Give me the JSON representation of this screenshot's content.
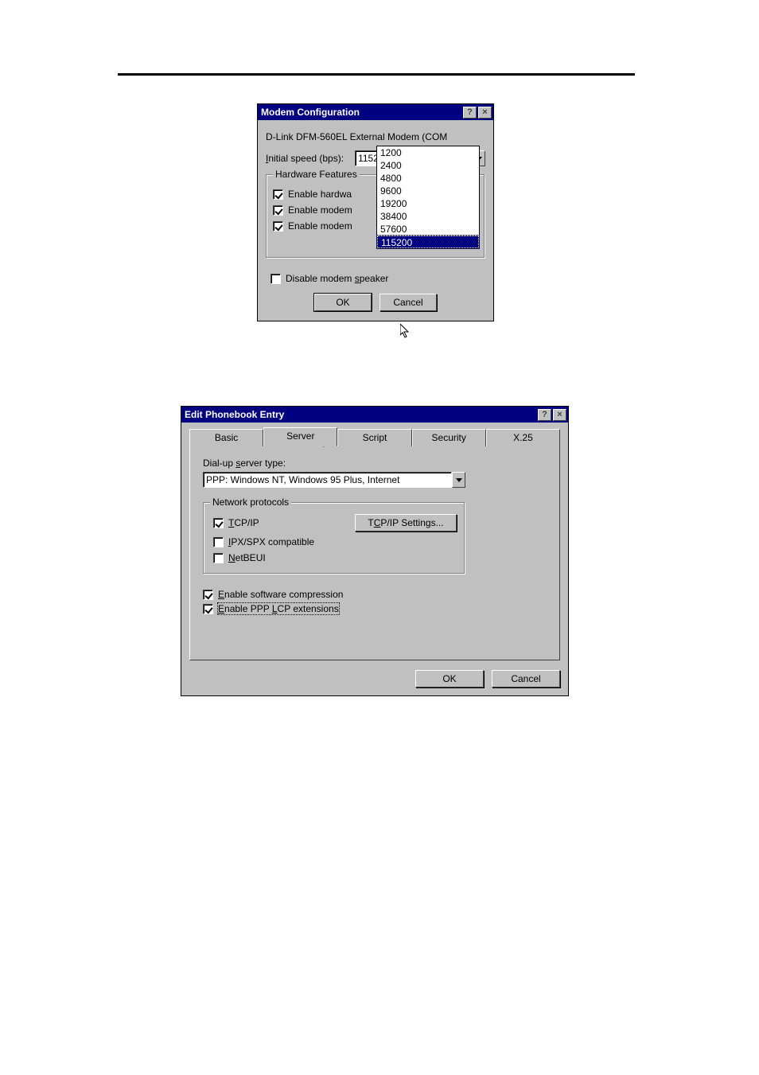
{
  "common": {
    "ok": "OK",
    "cancel": "Cancel",
    "help_glyph": "?",
    "close_glyph": "×"
  },
  "dialog1": {
    "title": "Modem Configuration",
    "modem_name": "D-Link DFM-560EL External Modem (COM",
    "initial_speed_label_u": "I",
    "initial_speed_label_rest": "nitial speed (bps):",
    "speed_selected": "115200",
    "speed_options": [
      "1200",
      "2400",
      "4800",
      "9600",
      "19200",
      "38400",
      "57600",
      "115200"
    ],
    "hw_group": "Hardware Features",
    "chk1": "Enable hardwa",
    "chk2": "Enable modem",
    "chk3": "Enable modem",
    "disable_speaker_pre": "Disable modem ",
    "disable_speaker_u": "s",
    "disable_speaker_post": "peaker"
  },
  "dialog2": {
    "title": "Edit Phonebook Entry",
    "tabs": [
      "Basic",
      "Server",
      "Script",
      "Security",
      "X.25"
    ],
    "server_type_pre": "Dial-up ",
    "server_type_u": "s",
    "server_type_post": "erver type:",
    "server_type_value": "PPP: Windows NT, Windows 95 Plus, Internet",
    "net_group": "Network protocols",
    "tcpip_u": "T",
    "tcpip_rest": "CP/IP",
    "tcpip_btn_pre": "T",
    "tcpip_btn_u": "C",
    "tcpip_btn_post": "P/IP Settings...",
    "ipx_u": "I",
    "ipx_rest": "PX/SPX compatible",
    "netbeui_u": "N",
    "netbeui_rest": "etBEUI",
    "swc_u": "E",
    "swc_rest": "nable software compression",
    "lcp_u": "E",
    "lcp_mid1": "nable PPP ",
    "lcp_u2": "L",
    "lcp_rest": "CP extensions"
  }
}
